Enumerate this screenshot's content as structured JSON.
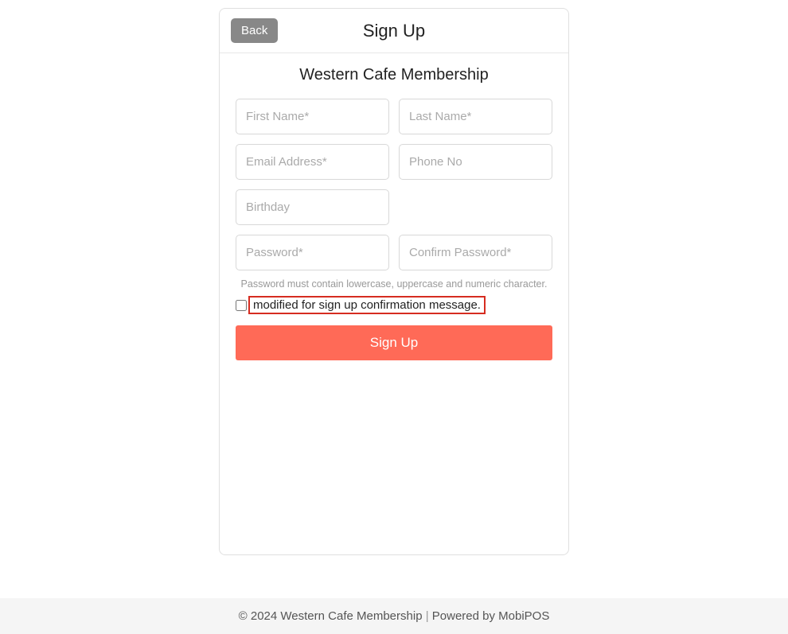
{
  "header": {
    "back_label": "Back",
    "title": "Sign Up"
  },
  "form": {
    "membership_title": "Western Cafe Membership",
    "first_name": {
      "placeholder": "First Name*",
      "value": ""
    },
    "last_name": {
      "placeholder": "Last Name*",
      "value": ""
    },
    "email": {
      "placeholder": "Email Address*",
      "value": ""
    },
    "phone": {
      "placeholder": "Phone No",
      "value": ""
    },
    "birthday": {
      "placeholder": "Birthday",
      "value": ""
    },
    "password": {
      "placeholder": "Password*",
      "value": ""
    },
    "confirm_password": {
      "placeholder": "Confirm Password*",
      "value": ""
    },
    "password_hint": "Password must contain lowercase, uppercase and numeric character.",
    "consent_text": "modified for sign up confirmation message.",
    "submit_label": "Sign Up"
  },
  "footer": {
    "copyright_prefix": "© 2024 ",
    "site_name": "Western Cafe Membership",
    "separator": " | ",
    "powered_by_prefix": "Powered by ",
    "powered_by_name": "MobiPOS"
  }
}
